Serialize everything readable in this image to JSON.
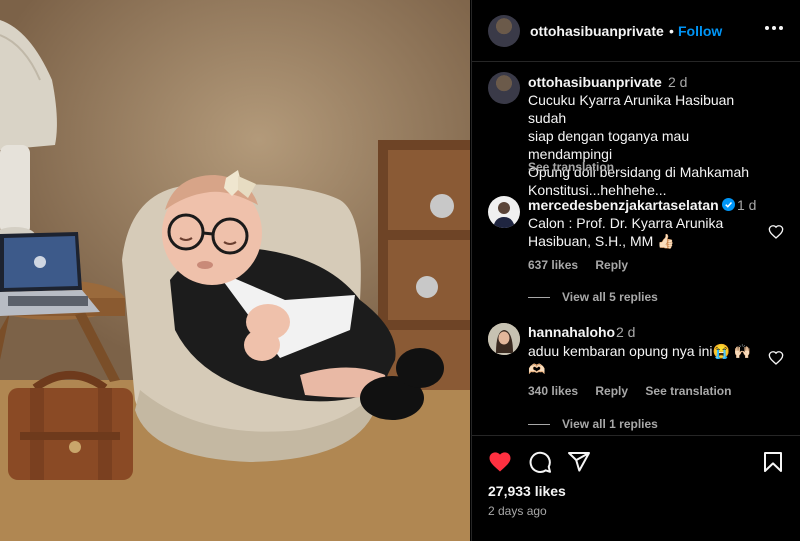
{
  "post": {
    "username": "ottohasibuanprivate",
    "dot": "•",
    "follow_label": "Follow",
    "more_icon": "more-horizontal-icon",
    "photo_icon": "photo"
  },
  "caption": {
    "username": "ottohasibuanprivate",
    "time": "2 d",
    "text_lines": [
      "Cucuku Kyarra Arunika Hasibuan sudah",
      "siap dengan toganya mau mendampingi",
      "Opung doli bersidang di Mahkamah",
      "Konstitusi...hehhehe..."
    ],
    "see_translation": "See translation"
  },
  "comments": [
    {
      "username": "mercedesbenzjakartaselatan",
      "verified": true,
      "time": "1 d",
      "text_lines": [
        "Calon : Prof. Dr. Kyarra Arunika",
        "Hasibuan, S.H., MM 👍🏻"
      ],
      "likes": "637 likes",
      "reply": "Reply",
      "view_replies": "View all 5 replies"
    },
    {
      "username": "hannahaloho",
      "verified": false,
      "time": "2 d",
      "text_lines": [
        "aduu kembaran opung nya ini😭 🙌🏻",
        "🫶🏻"
      ],
      "likes": "340 likes",
      "reply": "Reply",
      "see_translation": "See translation",
      "view_replies": "View all 1 replies"
    }
  ],
  "footer": {
    "likes": "27,933 likes",
    "ago": "2 days ago",
    "liked": true,
    "colors": {
      "liked_heart": "#ff3040",
      "link": "#0095f6",
      "muted": "#a8a8a8"
    }
  }
}
